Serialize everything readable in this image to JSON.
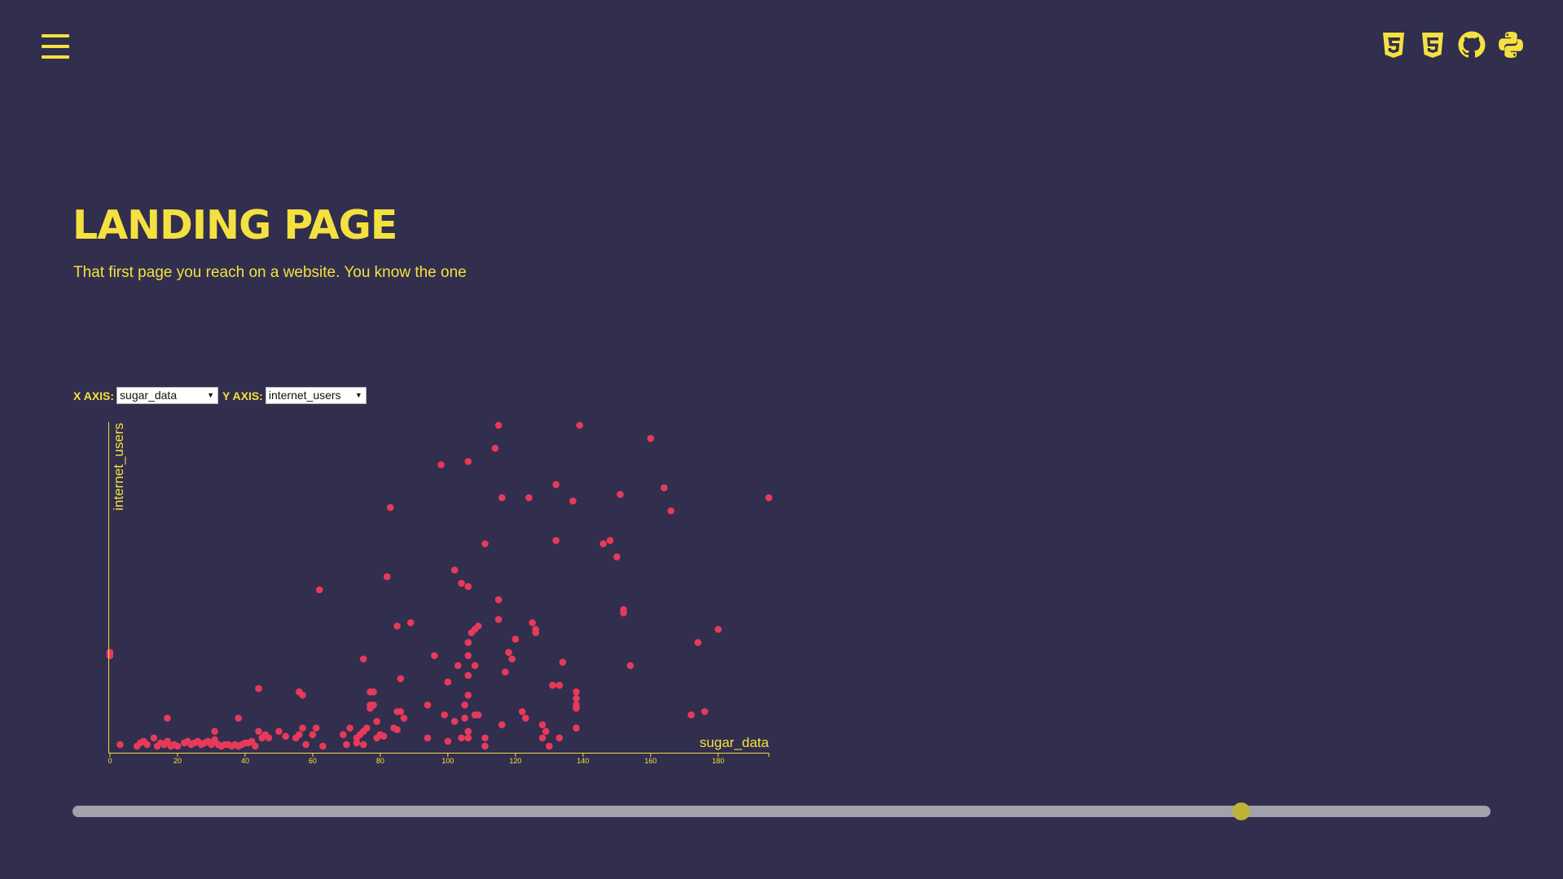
{
  "header": {
    "menu_icon": "hamburger-menu-icon",
    "icons": [
      "css3-icon",
      "html5-icon",
      "github-icon",
      "python-icon"
    ]
  },
  "hero": {
    "title": "LANDING PAGE",
    "subtitle": "That first page you reach on a website. You know the one"
  },
  "controls": {
    "x_label": "X AXIS:",
    "x_selected": "sugar_data",
    "y_label": "Y AXIS:",
    "y_selected": "internet_users"
  },
  "slider": {
    "value": 0.824
  },
  "colors": {
    "background": "#312e4e",
    "accent": "#f4e13f",
    "point": "#e73a5a",
    "slider_track": "#a3a1aa",
    "slider_thumb": "#bcb43a"
  },
  "chart_data": {
    "type": "scatter",
    "xlabel": "sugar_data",
    "ylabel": "internet_users",
    "xlim": [
      0,
      195
    ],
    "ylim": [
      0,
      100
    ],
    "x_ticks": [
      0,
      20,
      40,
      60,
      80,
      100,
      120,
      140,
      160,
      180
    ],
    "y_ticks_visible": false,
    "grid": false,
    "points": [
      [
        0,
        30
      ],
      [
        0,
        29
      ],
      [
        3,
        2
      ],
      [
        8,
        1.5
      ],
      [
        9,
        2.5
      ],
      [
        10,
        3
      ],
      [
        11,
        2
      ],
      [
        13,
        4
      ],
      [
        14,
        1.5
      ],
      [
        15,
        2.5
      ],
      [
        16,
        2
      ],
      [
        17,
        3
      ],
      [
        17,
        10
      ],
      [
        18,
        1.5
      ],
      [
        19,
        2
      ],
      [
        20,
        1.5
      ],
      [
        22,
        2.5
      ],
      [
        23,
        3
      ],
      [
        24,
        2
      ],
      [
        25,
        2.5
      ],
      [
        26,
        3
      ],
      [
        27,
        2
      ],
      [
        28,
        2.5
      ],
      [
        29,
        3
      ],
      [
        30,
        2
      ],
      [
        31,
        3.5
      ],
      [
        31,
        6
      ],
      [
        32,
        2
      ],
      [
        33,
        1.5
      ],
      [
        34,
        2
      ],
      [
        35,
        2
      ],
      [
        36,
        1.5
      ],
      [
        37,
        2
      ],
      [
        38,
        1.5
      ],
      [
        38,
        10
      ],
      [
        39,
        2
      ],
      [
        40,
        2.5
      ],
      [
        41,
        2.5
      ],
      [
        42,
        3
      ],
      [
        43,
        1.5
      ],
      [
        44,
        6
      ],
      [
        44,
        19
      ],
      [
        45,
        4
      ],
      [
        46,
        5
      ],
      [
        47,
        4
      ],
      [
        50,
        6
      ],
      [
        52,
        4.5
      ],
      [
        55,
        4
      ],
      [
        56,
        5
      ],
      [
        56,
        18
      ],
      [
        57,
        17
      ],
      [
        57,
        7
      ],
      [
        58,
        2
      ],
      [
        60,
        5
      ],
      [
        61,
        7
      ],
      [
        62,
        49
      ],
      [
        63,
        1.5
      ],
      [
        69,
        5
      ],
      [
        70,
        2
      ],
      [
        71,
        7
      ],
      [
        73,
        2.5
      ],
      [
        73,
        4
      ],
      [
        74,
        5
      ],
      [
        75,
        2
      ],
      [
        75,
        6
      ],
      [
        75,
        28
      ],
      [
        76,
        7
      ],
      [
        77,
        18
      ],
      [
        77,
        14
      ],
      [
        77,
        13
      ],
      [
        78,
        18
      ],
      [
        78,
        14
      ],
      [
        79,
        4
      ],
      [
        79,
        9
      ],
      [
        80,
        5
      ],
      [
        81,
        4.5
      ],
      [
        82,
        53
      ],
      [
        83,
        74
      ],
      [
        84,
        7
      ],
      [
        85,
        6.5
      ],
      [
        85,
        12
      ],
      [
        85,
        38
      ],
      [
        86,
        12
      ],
      [
        86,
        22
      ],
      [
        87,
        10
      ],
      [
        89,
        39
      ],
      [
        94,
        14
      ],
      [
        94,
        4
      ],
      [
        96,
        29
      ],
      [
        98,
        87
      ],
      [
        99,
        11
      ],
      [
        100,
        21
      ],
      [
        100,
        3
      ],
      [
        102,
        55
      ],
      [
        102,
        9
      ],
      [
        103,
        26
      ],
      [
        104,
        51
      ],
      [
        104,
        4
      ],
      [
        105,
        14
      ],
      [
        105,
        10
      ],
      [
        106,
        50
      ],
      [
        106,
        33
      ],
      [
        106,
        29
      ],
      [
        106,
        23
      ],
      [
        106,
        17
      ],
      [
        106,
        6
      ],
      [
        106,
        4
      ],
      [
        106,
        88
      ],
      [
        107,
        36
      ],
      [
        108,
        37
      ],
      [
        108,
        26
      ],
      [
        108,
        11
      ],
      [
        109,
        11
      ],
      [
        109,
        38
      ],
      [
        111,
        4
      ],
      [
        111,
        1.5
      ],
      [
        111,
        63
      ],
      [
        114,
        92
      ],
      [
        115,
        99
      ],
      [
        115,
        46
      ],
      [
        115,
        40
      ],
      [
        116,
        77
      ],
      [
        116,
        8
      ],
      [
        117,
        24
      ],
      [
        118,
        30
      ],
      [
        119,
        28
      ],
      [
        120,
        34
      ],
      [
        122,
        12
      ],
      [
        123,
        10
      ],
      [
        124,
        77
      ],
      [
        125,
        39
      ],
      [
        126,
        37
      ],
      [
        126,
        36
      ],
      [
        128,
        4
      ],
      [
        128,
        8
      ],
      [
        129,
        6
      ],
      [
        130,
        1.5
      ],
      [
        131,
        20
      ],
      [
        132,
        64
      ],
      [
        132,
        81
      ],
      [
        133,
        4
      ],
      [
        133,
        20
      ],
      [
        134,
        27
      ],
      [
        137,
        76
      ],
      [
        138,
        16
      ],
      [
        138,
        7
      ],
      [
        138,
        13
      ],
      [
        138,
        14
      ],
      [
        138,
        18
      ],
      [
        139,
        99
      ],
      [
        146,
        63
      ],
      [
        148,
        64
      ],
      [
        150,
        59
      ],
      [
        151,
        78
      ],
      [
        152,
        42
      ],
      [
        152,
        43
      ],
      [
        154,
        26
      ],
      [
        160,
        95
      ],
      [
        164,
        80
      ],
      [
        166,
        73
      ],
      [
        172,
        11
      ],
      [
        174,
        33
      ],
      [
        176,
        12
      ],
      [
        180,
        37
      ],
      [
        195,
        77
      ]
    ]
  }
}
